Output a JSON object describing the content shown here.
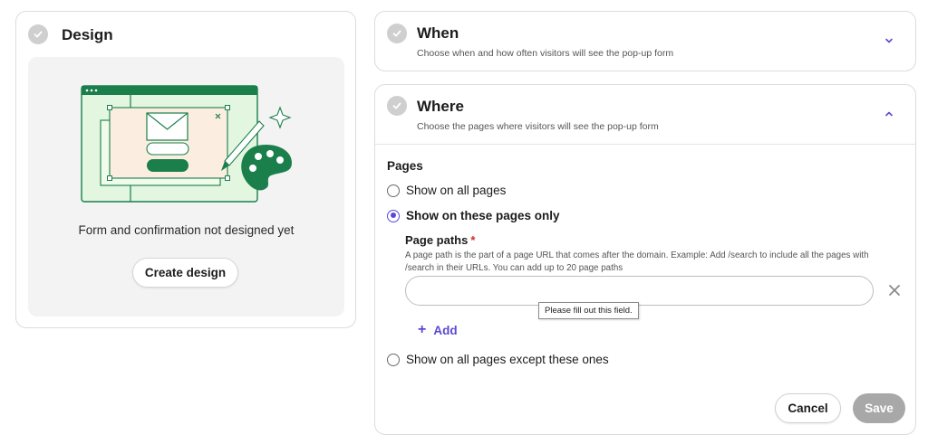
{
  "design": {
    "title": "Design",
    "empty_text": "Form and confirmation not designed yet",
    "create_label": "Create design"
  },
  "when": {
    "title": "When",
    "subtitle": "Choose when and how often visitors will see the pop-up form",
    "expanded": false
  },
  "where": {
    "title": "Where",
    "subtitle": "Choose the pages where visitors will see the pop-up form",
    "expanded": true,
    "pages_label": "Pages",
    "options": [
      {
        "label": "Show on all pages",
        "selected": false
      },
      {
        "label": "Show on these pages only",
        "selected": true
      },
      {
        "label": "Show on all pages except these ones",
        "selected": false
      }
    ],
    "paths_label": "Page paths",
    "required_mark": "*",
    "paths_help": "A page path is the part of a page URL that comes after the domain. Example: Add /search to include all the pages with /search in their URLs. You can add up to 20 page paths",
    "path_value": "",
    "tooltip": "Please fill out this field.",
    "add_label": "Add",
    "add_icon": "+",
    "cancel_label": "Cancel",
    "save_label": "Save"
  },
  "colors": {
    "accent": "#5a48d6",
    "brand_green": "#1a7f4b",
    "check_grey": "#cfcfcf",
    "save_disabled": "#a8a8a8",
    "required_red": "#d12a2a"
  },
  "icons": {
    "check": "check-icon",
    "chevron_when": "chevron-down-icon",
    "chevron_where": "chevron-up-icon",
    "remove": "close-icon",
    "add": "plus-icon"
  }
}
